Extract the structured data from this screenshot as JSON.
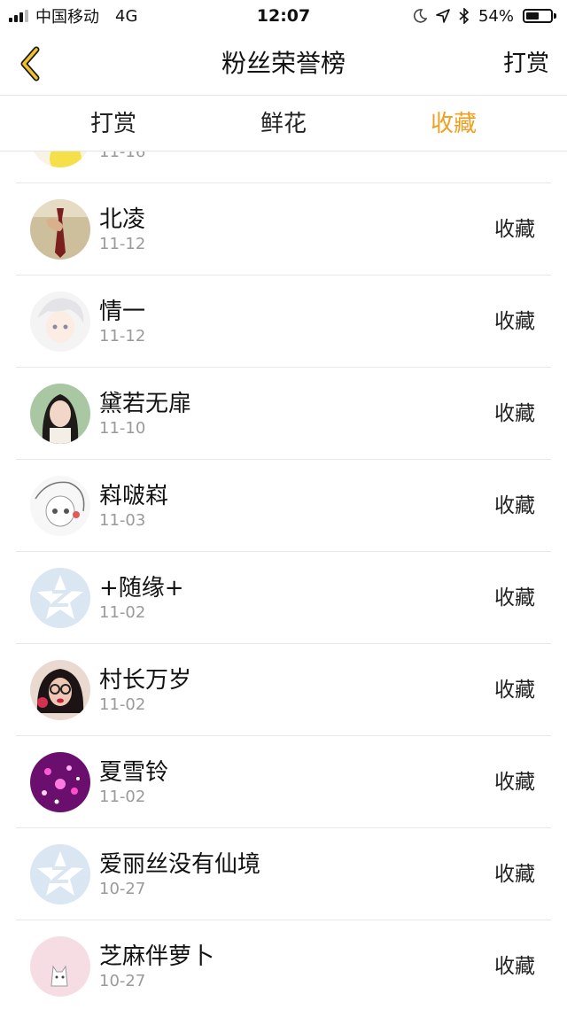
{
  "status_bar": {
    "carrier": "中国移动",
    "network": "4G",
    "time": "12:07",
    "battery": "54%",
    "battery_level": 0.54
  },
  "nav": {
    "back_icon": "chevron-left-icon",
    "title": "粉丝荣誉榜",
    "action_label": "打赏"
  },
  "tabs": [
    {
      "label": "打赏",
      "active": false
    },
    {
      "label": "鲜花",
      "active": false
    },
    {
      "label": "收藏",
      "active": true
    }
  ],
  "accent_color": "#f0a020",
  "list": [
    {
      "name": "",
      "date": "11-16",
      "kind": "",
      "avatar": "yellow-sketch"
    },
    {
      "name": "北凌",
      "date": "11-12",
      "kind": "收藏",
      "avatar": "tie-photo"
    },
    {
      "name": "情一",
      "date": "11-12",
      "kind": "收藏",
      "avatar": "anime-white"
    },
    {
      "name": "黛若无扉",
      "date": "11-10",
      "kind": "收藏",
      "avatar": "girl-portrait"
    },
    {
      "name": "嵙啵嵙",
      "date": "11-03",
      "kind": "收藏",
      "avatar": "anime-sketch"
    },
    {
      "name": "+随缘+",
      "date": "11-02",
      "kind": "收藏",
      "avatar": "qzone-default"
    },
    {
      "name": "村长万岁",
      "date": "11-02",
      "kind": "收藏",
      "avatar": "woman-glasses"
    },
    {
      "name": "夏雪铃",
      "date": "11-02",
      "kind": "收藏",
      "avatar": "purple-sparkle"
    },
    {
      "name": "爱丽丝没有仙境",
      "date": "10-27",
      "kind": "收藏",
      "avatar": "qzone-default"
    },
    {
      "name": "芝麻伴萝卜",
      "date": "10-27",
      "kind": "收藏",
      "avatar": "pink-cat"
    }
  ]
}
